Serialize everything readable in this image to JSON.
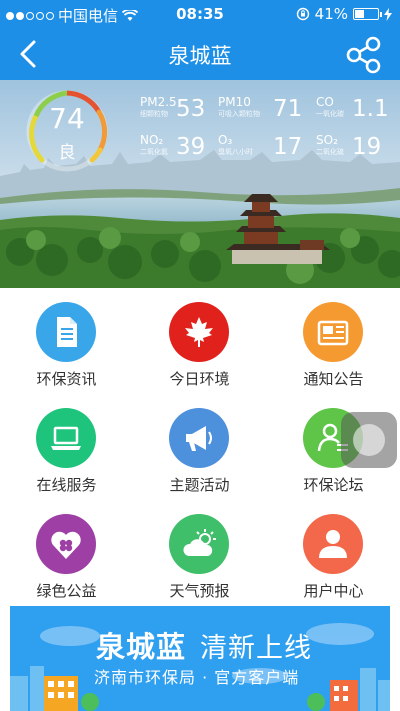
{
  "status_bar": {
    "carrier": "中国电信",
    "time": "08:35",
    "battery": "41%",
    "battery_level": 0.41
  },
  "nav": {
    "title": "泉城蓝",
    "back_icon": "back-arrow-icon",
    "share_icon": "share-icon"
  },
  "aqi": {
    "value": "74",
    "level": "良"
  },
  "pollutants": [
    {
      "name": "PM2.5",
      "sub": "细颗粒物",
      "value": "53"
    },
    {
      "name": "PM10",
      "sub": "可吸入颗粒物",
      "value": "71"
    },
    {
      "name": "CO",
      "sub": "一氧化碳",
      "value": "1.1"
    },
    {
      "name": "NO₂",
      "sub": "二氧化氮",
      "value": "39"
    },
    {
      "name": "O₃",
      "sub": "臭氧八小时",
      "value": "17"
    },
    {
      "name": "SO₂",
      "sub": "二氧化硫",
      "value": "19"
    }
  ],
  "menu": [
    {
      "label": "环保资讯",
      "icon": "document-icon",
      "color": "#3aa6ea"
    },
    {
      "label": "今日环境",
      "icon": "maple-leaf-icon",
      "color": "#e0211c"
    },
    {
      "label": "通知公告",
      "icon": "newspaper-icon",
      "color": "#f59a31"
    },
    {
      "label": "在线服务",
      "icon": "laptop-icon",
      "color": "#1fc47c"
    },
    {
      "label": "主题活动",
      "icon": "megaphone-icon",
      "color": "#4d90dc"
    },
    {
      "label": "环保论坛",
      "icon": "user-forum-icon",
      "color": "#5ec548"
    },
    {
      "label": "绿色公益",
      "icon": "clover-heart-icon",
      "color": "#9d3fa5"
    },
    {
      "label": "天气预报",
      "icon": "weather-sun-cloud-icon",
      "color": "#3fbf6a"
    },
    {
      "label": "用户中心",
      "icon": "user-icon",
      "color": "#f3684b"
    }
  ],
  "banner": {
    "brand": "泉城蓝",
    "tagline": "清新上线",
    "subtitle": "济南市环保局 · 官方客户端"
  }
}
